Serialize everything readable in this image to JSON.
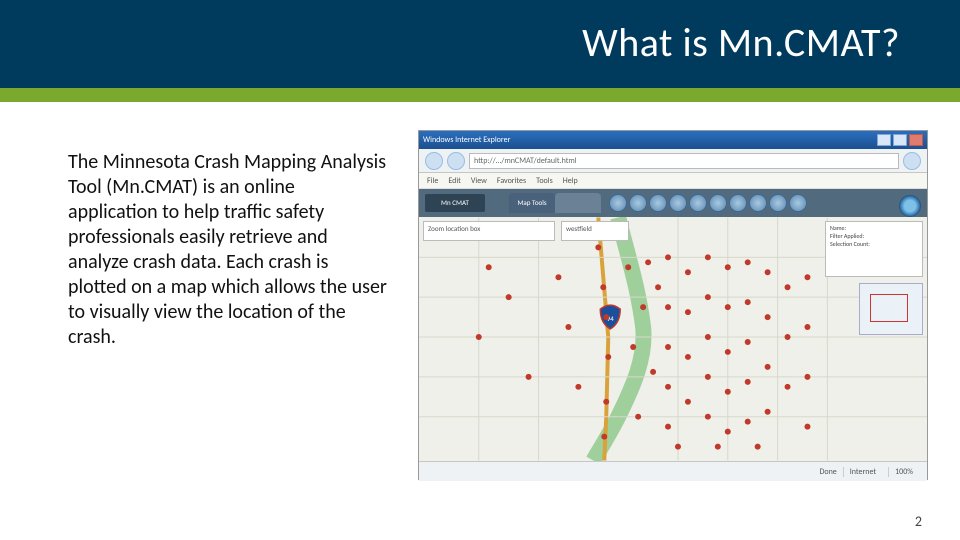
{
  "header": {
    "title": "What is Mn.CMAT?"
  },
  "body": {
    "paragraph": "The Minnesota Crash Mapping Analysis Tool (Mn.CMAT) is an online application to help traffic safety professionals easily retrieve and analyze crash data. Each crash is plotted on a map which allows the user to visually view the location of the crash."
  },
  "footer": {
    "page_number": "2"
  },
  "screenshot": {
    "window_title": "Windows Internet Explorer",
    "url_text": "http://…/mnCMAT/default.html",
    "menubar": [
      "File",
      "Edit",
      "View",
      "Favorites",
      "Tools",
      "Help"
    ],
    "app_logo": "Mn CMAT",
    "toolbar_tabs": [
      "Map Tools",
      ""
    ],
    "left_panel_label": "Zoom location box",
    "left_panel2_label": "westfield",
    "info_panel": {
      "line1": "Name:",
      "line2": "Filter Applied:",
      "line3": "Selection Count:"
    },
    "statusbar": {
      "done": "Done",
      "zone": "Internet",
      "zoom": "100%"
    }
  }
}
